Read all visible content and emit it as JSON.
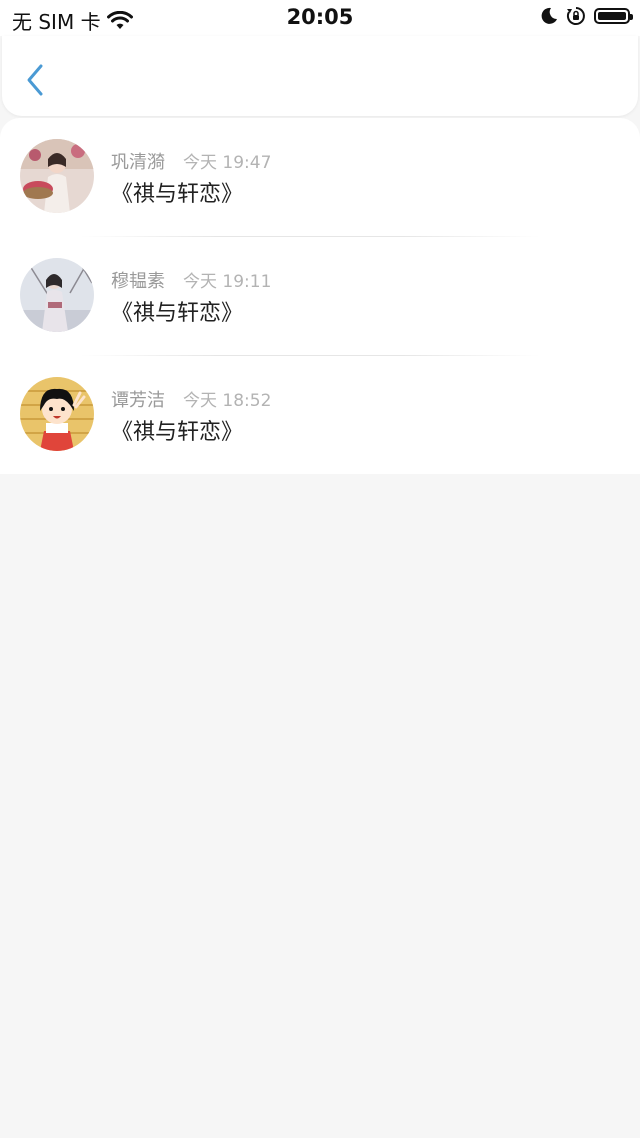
{
  "status_bar": {
    "carrier": "无 SIM 卡",
    "time": "20:05",
    "icons": [
      "wifi-icon",
      "moon-icon",
      "rotation-lock-icon",
      "battery-icon"
    ]
  },
  "nav": {
    "back_icon": "chevron-left-icon",
    "accent_color": "#4a9ad4"
  },
  "comments": [
    {
      "name": "巩清漪",
      "time": "今天 19:47",
      "text": "《祺与轩恋》"
    },
    {
      "name": "穆韫素",
      "time": "今天 19:11",
      "text": "《祺与轩恋》"
    },
    {
      "name": "谭芳洁",
      "time": "今天 18:52",
      "text": "《祺与轩恋》"
    }
  ]
}
